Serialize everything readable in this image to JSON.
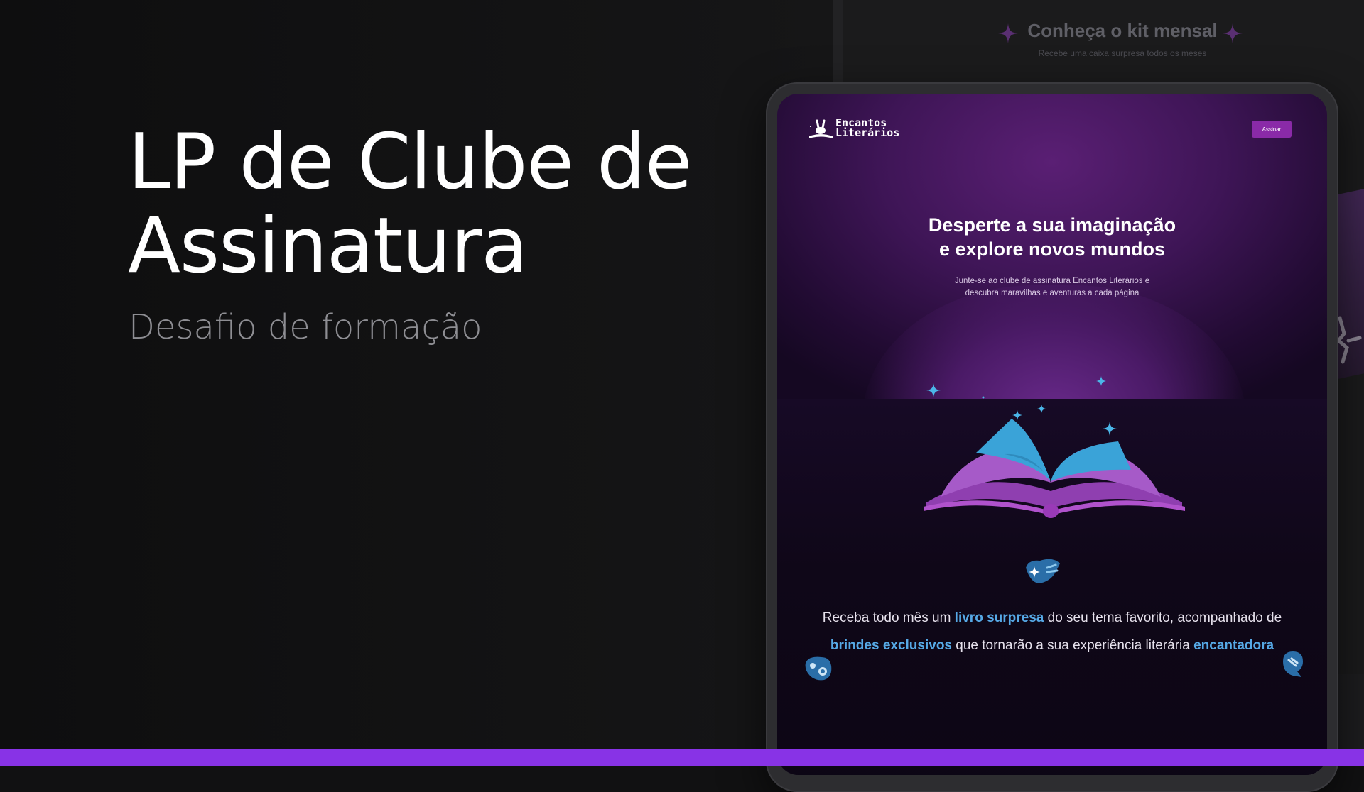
{
  "hero": {
    "title_line1": "LP de Clube de",
    "title_line2": "Assinatura",
    "subtitle": "Desafio de formação"
  },
  "background_panel": {
    "title": "Conheça o kit mensal",
    "subtitle": "Recebe uma caixa surpresa todos os meses"
  },
  "mockup": {
    "logo": {
      "line1": "Encantos",
      "line2": "Literários"
    },
    "subscribe_button": "Assinar",
    "headline_line1": "Desperte a sua imaginação",
    "headline_line2": "e explore novos mundos",
    "subline_line1": "Junte-se ao clube de assinatura Encantos Literários e",
    "subline_line2": "descubra maravilhas e aventuras a cada página",
    "description": {
      "part1": "Receba todo mês um ",
      "highlight1": "livro surpresa",
      "part2": " do seu tema favorito, acompanhado de ",
      "highlight2": "brindes exclusivos",
      "part3": " que tornarão a sua experiência literária ",
      "highlight3": "encantadora"
    },
    "icons": [
      "rabbit-logo-icon",
      "open-book-illustration",
      "sparkle-star-icon",
      "hand-sparkle-icon",
      "theater-mask-icon",
      "magic-hand-icon"
    ]
  },
  "colors": {
    "page_background": "#111112",
    "accent_bar": "#8833e6",
    "mockup_purple": "#5a1f74",
    "button_purple": "#8a2aa8",
    "highlight_blue": "#56a9e6",
    "star_blue": "#4bb6e8"
  }
}
